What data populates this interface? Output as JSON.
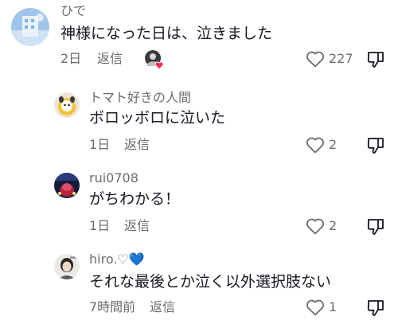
{
  "comments": [
    {
      "username": "ひで",
      "text": "神様になった日は、泣きました",
      "time": "2日",
      "reply_label": "返信",
      "likes": "227",
      "creator_liked": true
    },
    {
      "username": "トマト好きの人間",
      "text": "ボロッボロに泣いた",
      "time": "1日",
      "reply_label": "返信",
      "likes": "2"
    },
    {
      "username": "rui0708",
      "text": "がちわかる！",
      "time": "1日",
      "reply_label": "返信",
      "likes": "2"
    },
    {
      "username": "hiro.♡💙",
      "text": "それな最後とか泣く以外選択肢ない",
      "time": "7時間前",
      "reply_label": "返信",
      "likes": "1"
    }
  ],
  "colors": {
    "text": "#161823",
    "secondary": "#6b6b70",
    "heart_red": "#fe2c55"
  }
}
